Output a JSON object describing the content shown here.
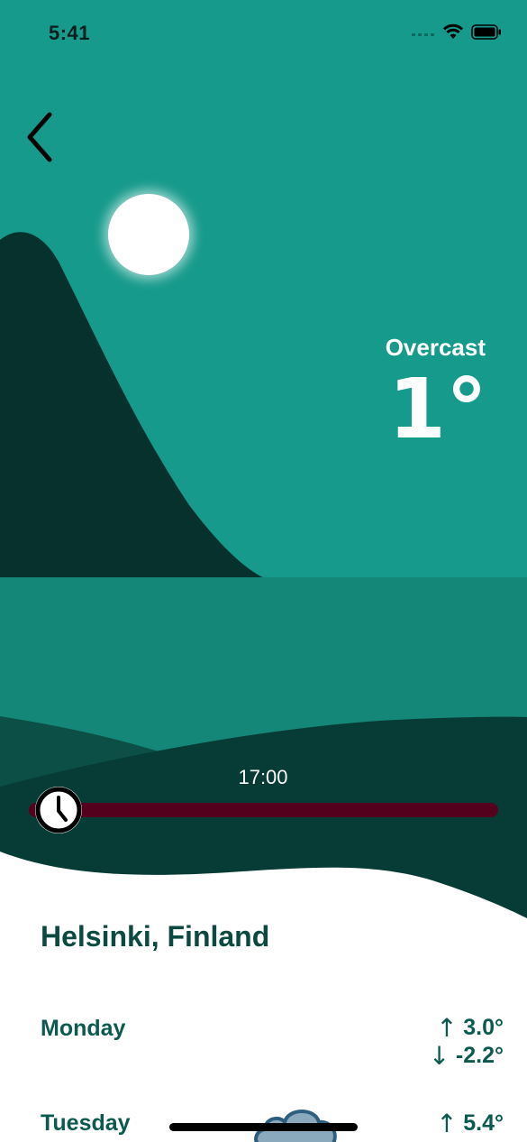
{
  "status_bar": {
    "time": "5:41",
    "icons": [
      "signal-icon",
      "wifi-icon",
      "battery-icon"
    ]
  },
  "header": {
    "back_icon": "chevron-left-icon"
  },
  "weather": {
    "condition": "Overcast",
    "temperature": "1°"
  },
  "time_slider": {
    "label": "17:00",
    "position_fraction": 0.0,
    "handle_icon": "clock-icon"
  },
  "location": {
    "city": "Helsinki, Finland"
  },
  "forecast": [
    {
      "day": "Monday",
      "high": "3.0°",
      "low": "-2.2°"
    },
    {
      "day": "Tuesday",
      "high": "5.4°"
    }
  ],
  "colors": {
    "sky": "#169a8b",
    "mountain": "#06312c",
    "water": "#158778",
    "near_hill": "#073b35",
    "slider_track": "#54011e",
    "text_dark": "#0c5a4f"
  }
}
